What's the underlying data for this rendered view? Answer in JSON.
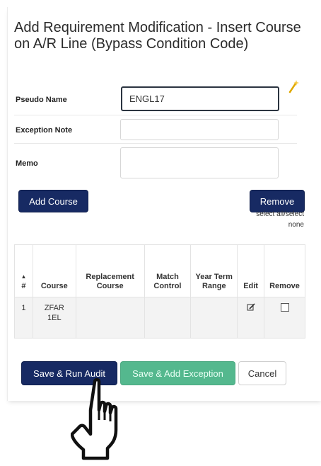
{
  "dialog": {
    "title": "Add Requirement Modification - Insert Course on A/R Line (Bypass Condition Code)"
  },
  "form": {
    "pseudo_name_label": "Pseudo Name",
    "pseudo_name_value": "ENGL17",
    "exception_note_label": "Exception Note",
    "exception_note_value": "",
    "memo_label": "Memo",
    "memo_value": ""
  },
  "actions": {
    "add_course": "Add Course",
    "remove": "Remove",
    "select_all_note": "select all/select none",
    "save_run_audit": "Save & Run Audit",
    "save_add_exception": "Save & Add Exception",
    "cancel": "Cancel"
  },
  "table": {
    "sort_caret": "▲",
    "columns": [
      "#",
      "Course",
      "Replacement Course",
      "Match Control",
      "Year Term Range",
      "Edit",
      "Remove"
    ],
    "rows": [
      {
        "num": "1",
        "course": "ZFAR 1EL",
        "replacement": "",
        "match": "",
        "range": "",
        "edit_icon": "edit-icon",
        "remove_checked": false
      }
    ]
  },
  "colors": {
    "primary": "#172a63",
    "success": "#54b88e",
    "wand": "#f0c419"
  },
  "icons": [
    "magic-wand-icon",
    "edit-icon",
    "pointer-hand-icon"
  ]
}
